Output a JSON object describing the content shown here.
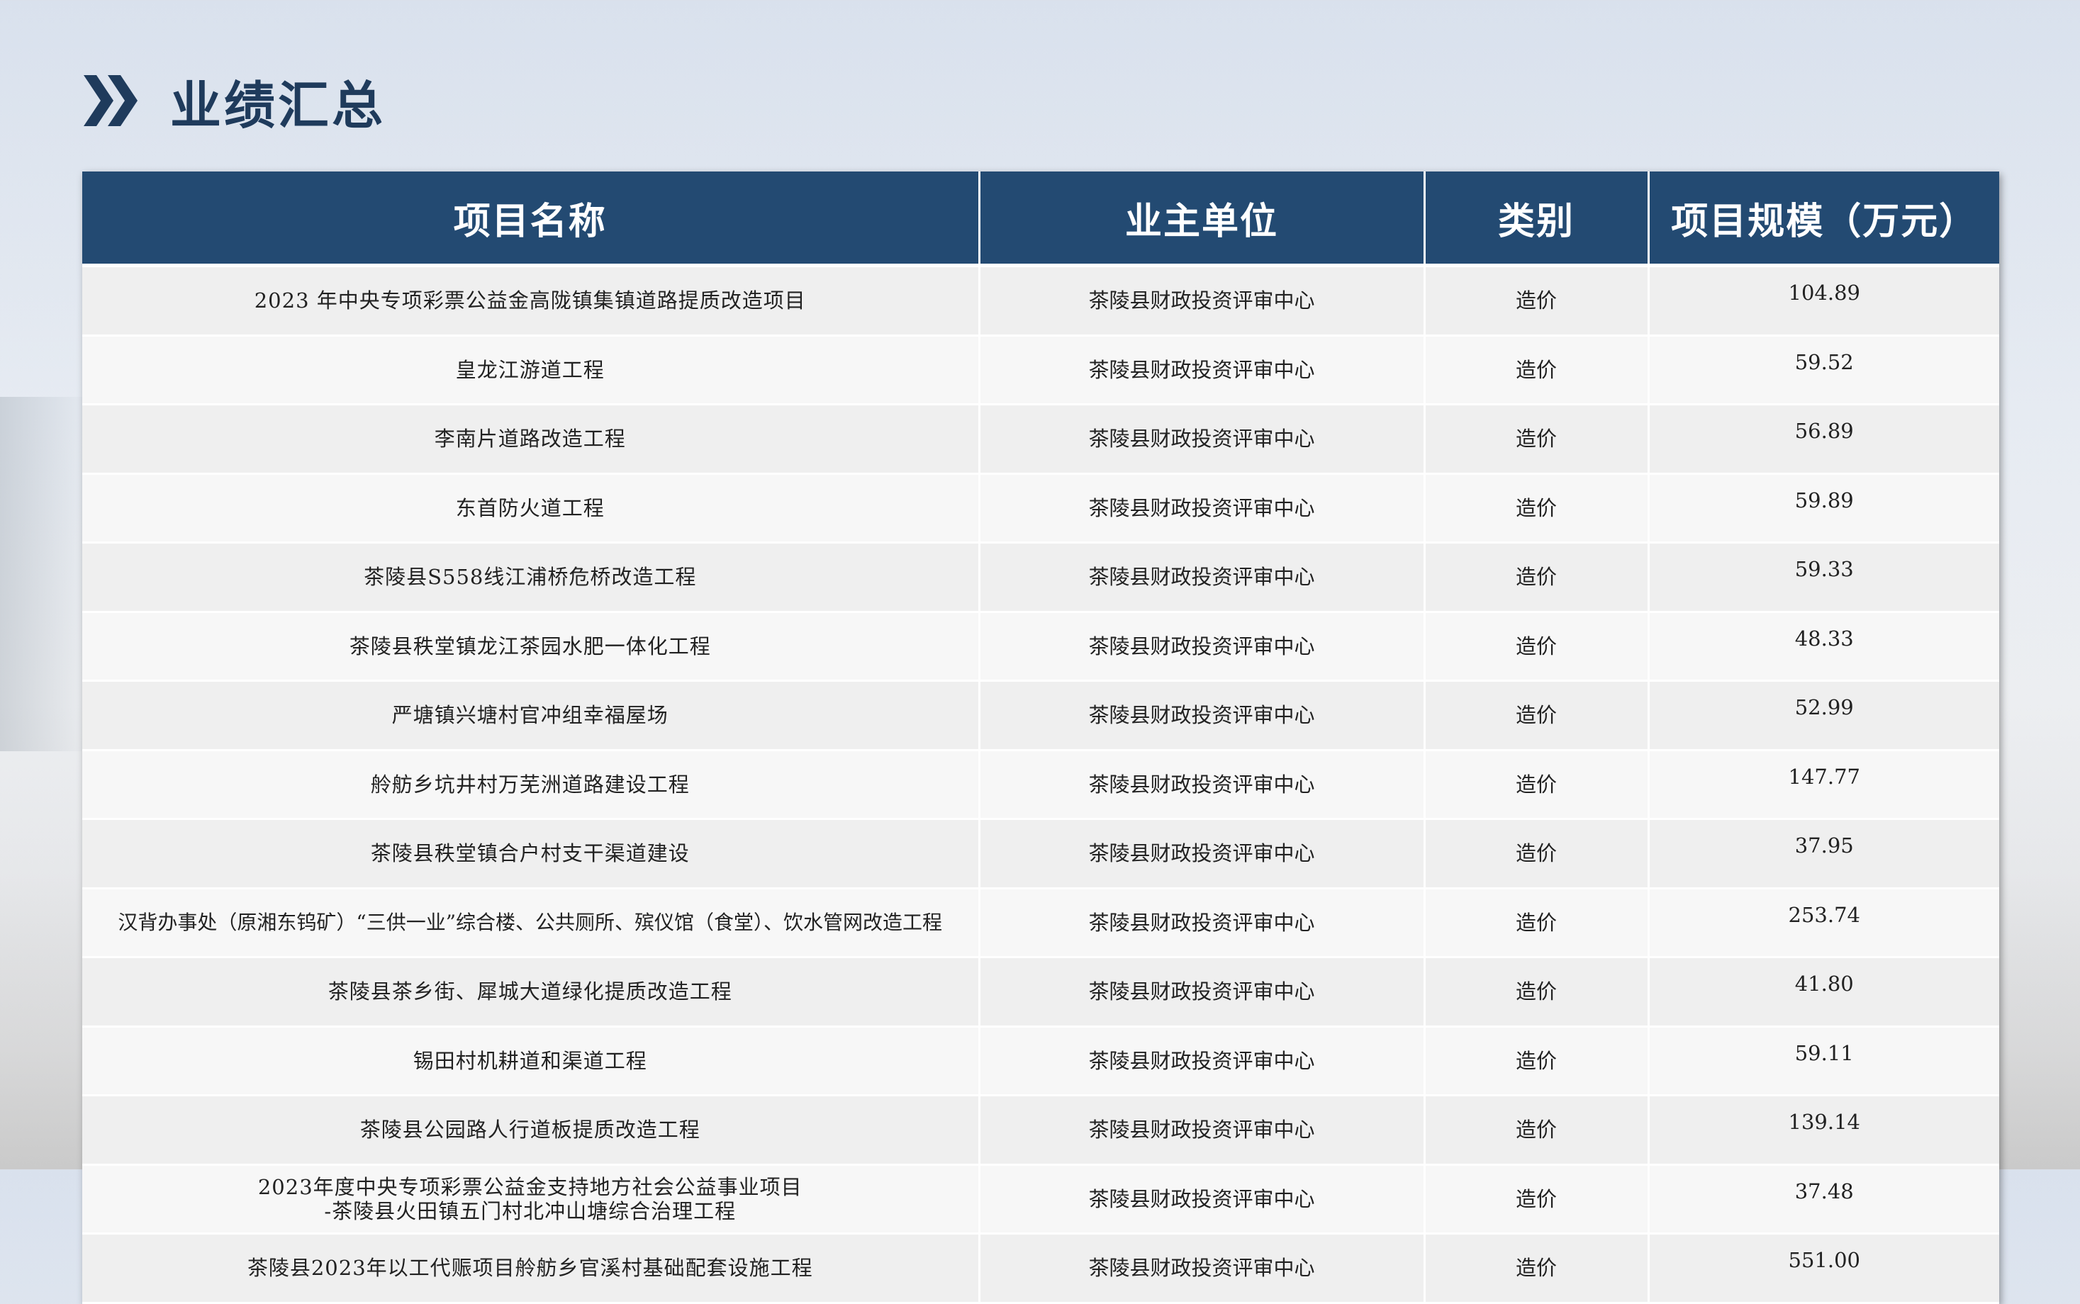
{
  "title": "业绩汇总",
  "colors": {
    "accent": "#234a72",
    "title": "#1f3b5c"
  },
  "icons": {
    "title_icon": "double-chevron-right-icon"
  },
  "table": {
    "headers": [
      "项目名称",
      "业主单位",
      "类别",
      "项目规模（万元）"
    ],
    "rows": [
      {
        "name": "2023 年中央专项彩票公益金高陇镇集镇道路提质改造项目",
        "owner": "茶陵县财政投资评审中心",
        "category": "造价",
        "scale": "104.89"
      },
      {
        "name": "皇龙江游道工程",
        "owner": "茶陵县财政投资评审中心",
        "category": "造价",
        "scale": "59.52"
      },
      {
        "name": "李南片道路改造工程",
        "owner": "茶陵县财政投资评审中心",
        "category": "造价",
        "scale": "56.89"
      },
      {
        "name": "东首防火道工程",
        "owner": "茶陵县财政投资评审中心",
        "category": "造价",
        "scale": "59.89"
      },
      {
        "name": "茶陵县S558线江浦桥危桥改造工程",
        "owner": "茶陵县财政投资评审中心",
        "category": "造价",
        "scale": "59.33"
      },
      {
        "name": "茶陵县秩堂镇龙江茶园水肥一体化工程",
        "owner": "茶陵县财政投资评审中心",
        "category": "造价",
        "scale": "48.33"
      },
      {
        "name": "严塘镇兴塘村官冲组幸福屋场",
        "owner": "茶陵县财政投资评审中心",
        "category": "造价",
        "scale": "52.99"
      },
      {
        "name": "舲舫乡坑井村万芜洲道路建设工程",
        "owner": "茶陵县财政投资评审中心",
        "category": "造价",
        "scale": "147.77"
      },
      {
        "name": "茶陵县秩堂镇合户村支干渠道建设",
        "owner": "茶陵县财政投资评审中心",
        "category": "造价",
        "scale": "37.95"
      },
      {
        "name": "汉背办事处（原湘东钨矿）“三供一业”综合楼、公共厕所、殡仪馆（食堂）、饮水管网改造工程",
        "owner": "茶陵县财政投资评审中心",
        "category": "造价",
        "scale": "253.74"
      },
      {
        "name": "茶陵县茶乡街、犀城大道绿化提质改造工程",
        "owner": "茶陵县财政投资评审中心",
        "category": "造价",
        "scale": "41.80"
      },
      {
        "name": "锡田村机耕道和渠道工程",
        "owner": "茶陵县财政投资评审中心",
        "category": "造价",
        "scale": "59.11"
      },
      {
        "name": "茶陵县公园路人行道板提质改造工程",
        "owner": "茶陵县财政投资评审中心",
        "category": "造价",
        "scale": "139.14"
      },
      {
        "name_line1": "2023年度中央专项彩票公益金支持地方社会公益事业项目",
        "name_line2": "-茶陵县火田镇五门村北冲山塘综合治理工程",
        "owner": "茶陵县财政投资评审中心",
        "category": "造价",
        "scale": "37.48"
      },
      {
        "name": "茶陵县2023年以工代赈项目舲舫乡官溪村基础配套设施工程",
        "owner": "茶陵县财政投资评审中心",
        "category": "造价",
        "scale": "551.00"
      }
    ]
  }
}
